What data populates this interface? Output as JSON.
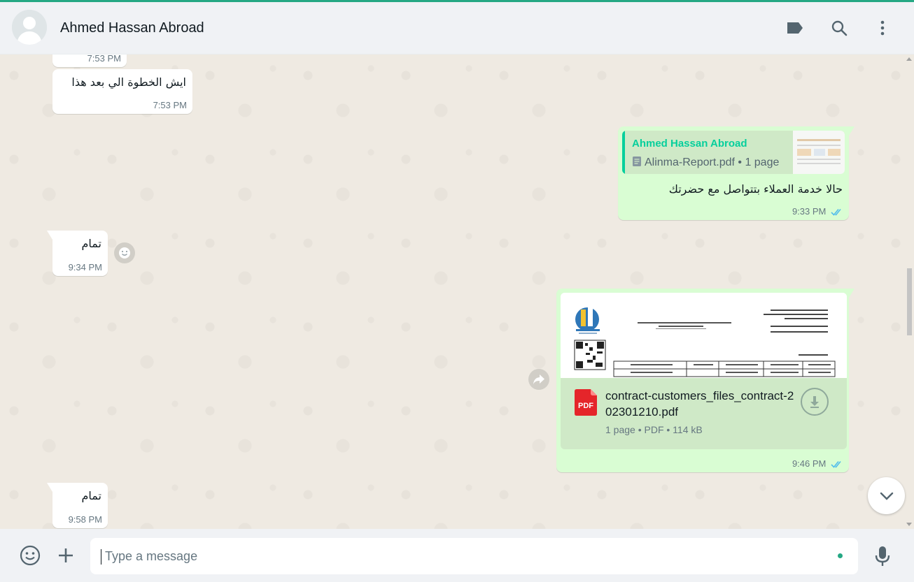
{
  "header": {
    "contact_name": "Ahmed Hassan Abroad",
    "icons": [
      "label-icon",
      "search-icon",
      "menu-icon"
    ]
  },
  "messages": {
    "m0_time": "7:53 PM",
    "m1_text": "ايش الخطوة الي بعد هذا",
    "m1_time": "7:53 PM",
    "m2_quote_name": "Ahmed Hassan Abroad",
    "m2_quote_doc": "Alinma-Report.pdf • 1 page",
    "m2_text": "حالا خدمة العملاء بتتواصل مع حضرتك",
    "m2_time": "9:33 PM",
    "m3_text": "تمام",
    "m3_time": "9:34 PM",
    "m4_file_name": "contract-customers_files_contract-202301210.pdf",
    "m4_file_meta": "1 page • PDF • 114 kB",
    "m4_pdf_label": "PDF",
    "m4_time": "9:46 PM",
    "m5_text": "تمام",
    "m5_time": "9:58 PM"
  },
  "composer": {
    "placeholder": "Type a message"
  },
  "colors": {
    "accent": "#25a884",
    "outgoing_bubble": "#d9fdd3",
    "incoming_bubble": "#ffffff",
    "read_ticks": "#53bdeb",
    "pdf_red": "#e5252a"
  }
}
